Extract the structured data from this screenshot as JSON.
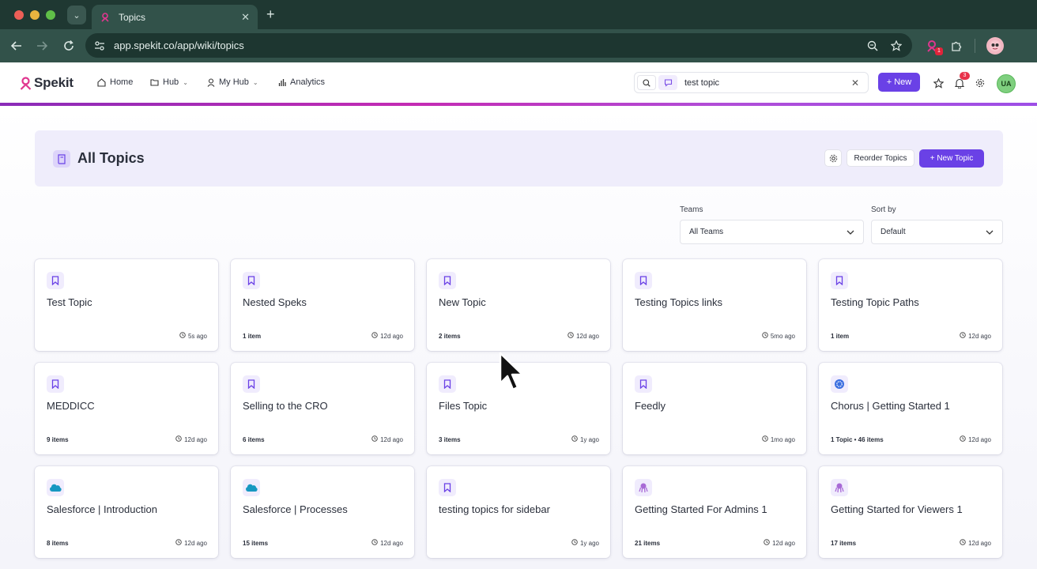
{
  "browser": {
    "tab_title": "Topics",
    "url": "app.spekit.co/app/wiki/topics",
    "extension_badge": "1"
  },
  "app": {
    "logo_text": "Spekit",
    "nav": [
      {
        "label": "Home",
        "icon": "home-icon"
      },
      {
        "label": "Hub",
        "icon": "folder-icon",
        "has_dropdown": true
      },
      {
        "label": "My Hub",
        "icon": "user-icon",
        "has_dropdown": true
      },
      {
        "label": "Analytics",
        "icon": "bar-chart-icon"
      }
    ],
    "search_value": "test topic",
    "new_button": "+ New",
    "notification_count": "3",
    "avatar_initials": "UA",
    "accent_color": "#6a41e6"
  },
  "page": {
    "title": "All Topics",
    "reorder_label": "Reorder Topics",
    "new_topic_label": "+ New Topic",
    "filters": {
      "teams_label": "Teams",
      "teams_value": "All Teams",
      "sort_label": "Sort by",
      "sort_value": "Default"
    }
  },
  "topics": [
    {
      "title": "Test Topic",
      "count": "",
      "time": "5s ago",
      "icon": "bookmark-icon"
    },
    {
      "title": "Nested Speks",
      "count": "1 item",
      "time": "12d ago",
      "icon": "bookmark-icon"
    },
    {
      "title": "New Topic",
      "count": "2 items",
      "time": "12d ago",
      "icon": "bookmark-icon"
    },
    {
      "title": "Testing Topics links",
      "count": "",
      "time": "5mo ago",
      "icon": "bookmark-icon"
    },
    {
      "title": "Testing Topic Paths",
      "count": "1 item",
      "time": "12d ago",
      "icon": "bookmark-icon"
    },
    {
      "title": "MEDDICC",
      "count": "9 items",
      "time": "12d ago",
      "icon": "bookmark-icon"
    },
    {
      "title": "Selling to the CRO",
      "count": "6 items",
      "time": "12d ago",
      "icon": "bookmark-icon"
    },
    {
      "title": "Files Topic",
      "count": "3 items",
      "time": "1y ago",
      "icon": "bookmark-icon"
    },
    {
      "title": "Feedly",
      "count": "",
      "time": "1mo ago",
      "icon": "bookmark-icon"
    },
    {
      "title": "Chorus | Getting Started 1",
      "count": "1 Topic  •  46 items",
      "time": "12d ago",
      "icon": "chorus-icon"
    },
    {
      "title": "Salesforce | Introduction",
      "count": "8 items",
      "time": "12d ago",
      "icon": "salesforce-cloud-icon"
    },
    {
      "title": "Salesforce | Processes",
      "count": "15 items",
      "time": "12d ago",
      "icon": "salesforce-cloud-icon"
    },
    {
      "title": "testing topics for sidebar",
      "count": "",
      "time": "1y ago",
      "icon": "bookmark-icon"
    },
    {
      "title": "Getting Started For Admins 1",
      "count": "21 items",
      "time": "12d ago",
      "icon": "spekit-octopus-icon"
    },
    {
      "title": "Getting Started for Viewers 1",
      "count": "17 items",
      "time": "12d ago",
      "icon": "spekit-octopus-icon"
    }
  ]
}
